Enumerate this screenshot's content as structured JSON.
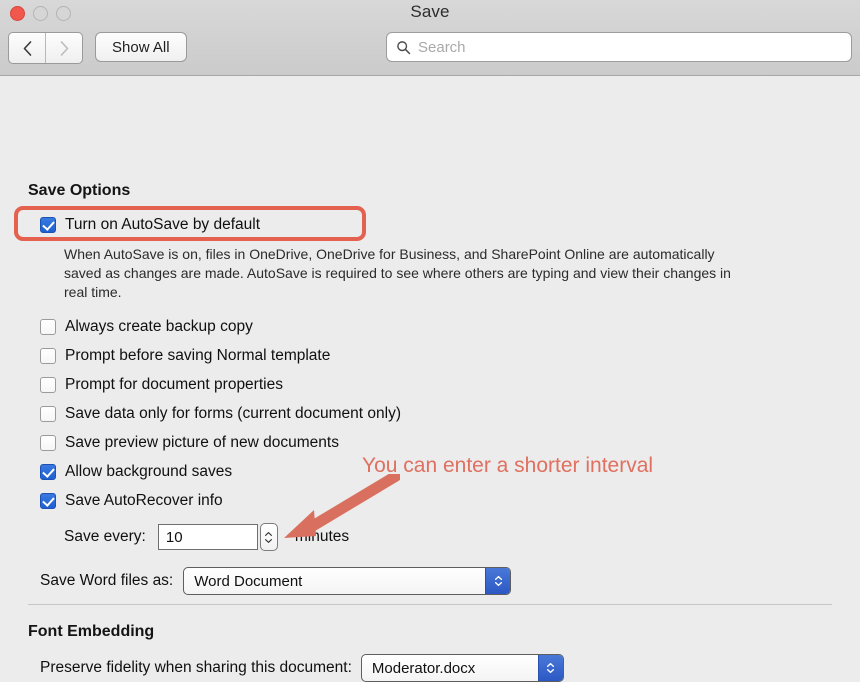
{
  "window": {
    "title": "Save",
    "traffic_lights": [
      "close",
      "minimize",
      "zoom"
    ]
  },
  "toolbar": {
    "back_icon": "chevron-left-icon",
    "forward_icon": "chevron-right-icon",
    "show_all_label": "Show All",
    "search": {
      "icon": "search-icon",
      "placeholder": "Search",
      "value": ""
    }
  },
  "save_options": {
    "heading": "Save Options",
    "autosave": {
      "label": "Turn on AutoSave by default",
      "checked": true,
      "highlighted": true
    },
    "description": "When AutoSave is on, files in OneDrive, OneDrive for Business, and SharePoint Online are automatically saved as changes are made. AutoSave is required to see where others are typing and view their changes in real time.",
    "checkboxes": [
      {
        "label": "Always create backup copy",
        "checked": false
      },
      {
        "label": "Prompt before saving Normal template",
        "checked": false
      },
      {
        "label": "Prompt for document properties",
        "checked": false
      },
      {
        "label": "Save data only for forms (current document only)",
        "checked": false
      },
      {
        "label": "Save preview picture of new documents",
        "checked": false
      },
      {
        "label": "Allow background saves",
        "checked": true
      },
      {
        "label": "Save AutoRecover info",
        "checked": true
      }
    ],
    "save_every": {
      "label": "Save every:",
      "value": "10",
      "unit": "minutes",
      "stepper_icon": "stepper-up-down-icon"
    },
    "save_word_files_as": {
      "label": "Save Word files as:",
      "value": "Word Document",
      "arrow_icon": "popup-up-down-icon"
    }
  },
  "font_embedding": {
    "heading": "Font Embedding",
    "preserve_fidelity": {
      "label": "Preserve fidelity when sharing this document:",
      "value": "Moderator.docx",
      "arrow_icon": "popup-up-down-icon"
    }
  },
  "annotation": {
    "text": "You can enter a shorter interval",
    "color": "#e0705f",
    "arrow_icon": "annotation-arrow-icon",
    "highlight_color": "#e4614f"
  }
}
